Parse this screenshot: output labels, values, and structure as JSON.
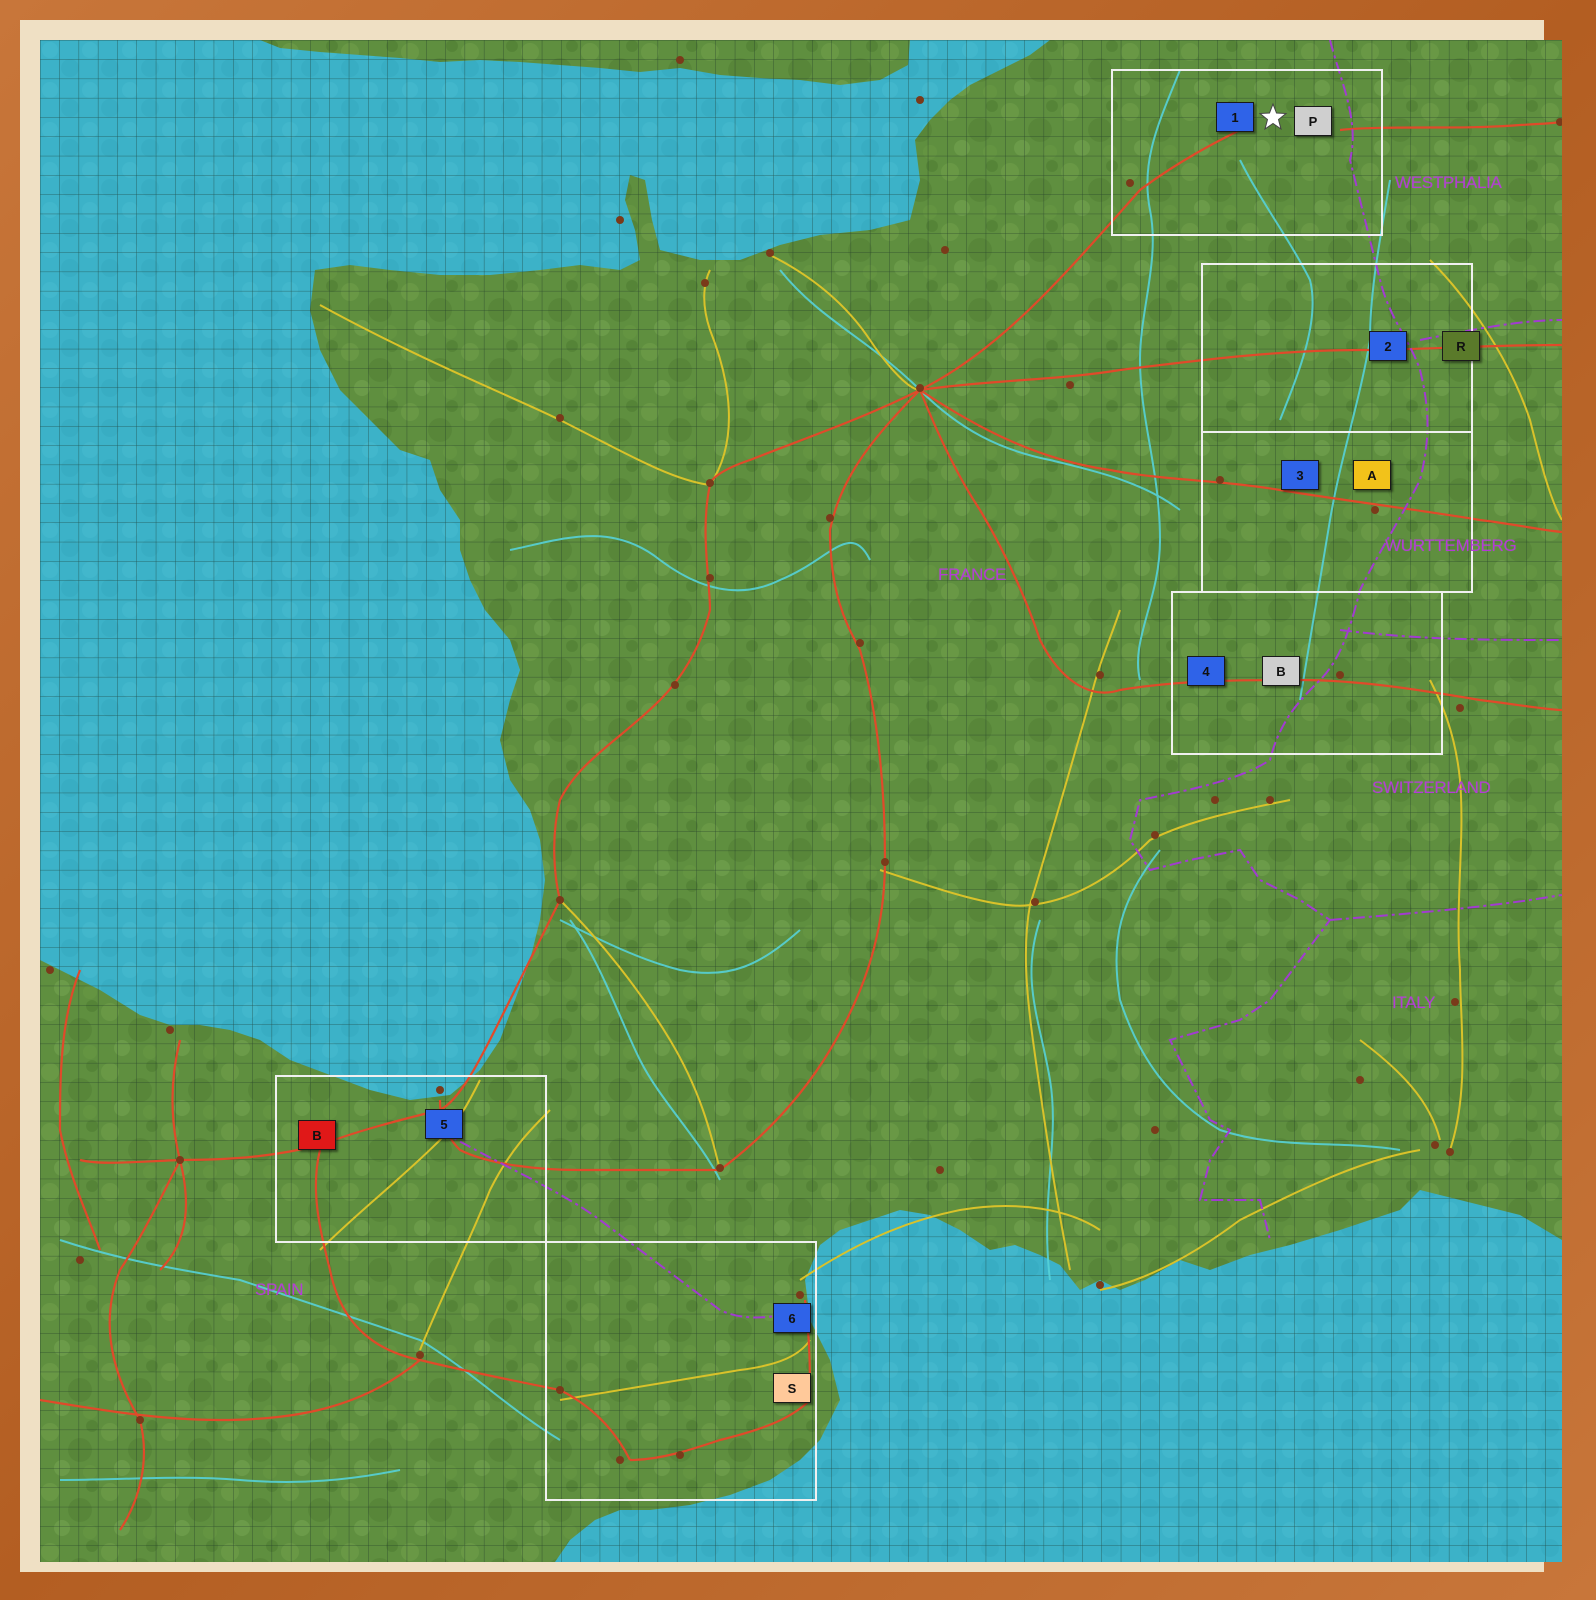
{
  "map": {
    "countries": [
      {
        "id": "westphalia",
        "label": "WESTPHALIA"
      },
      {
        "id": "wurttemberg",
        "label": "WURTTEMBERG"
      },
      {
        "id": "france",
        "label": "FRANCE"
      },
      {
        "id": "switzerland",
        "label": "SWITZERLAND"
      },
      {
        "id": "italy",
        "label": "ITALY"
      },
      {
        "id": "spain",
        "label": "SPAIN"
      }
    ],
    "colors": {
      "sea": "#3db3c9",
      "land": "#5f8f3f",
      "grid": "#1f3b2a",
      "road_main": "#e04a2a",
      "road_secondary": "#d9c22a",
      "river": "#56d2d8",
      "border": "#a23bd1",
      "sector_box": "#f0f0f0"
    }
  },
  "counters": [
    {
      "id": "unit-1",
      "label": "1",
      "color": "#2f63e8"
    },
    {
      "id": "unit-P",
      "label": "P",
      "color": "#cfcfcf"
    },
    {
      "id": "unit-2",
      "label": "2",
      "color": "#2f63e8"
    },
    {
      "id": "unit-R",
      "label": "R",
      "color": "#5a7a2a"
    },
    {
      "id": "unit-3",
      "label": "3",
      "color": "#2f63e8"
    },
    {
      "id": "unit-A",
      "label": "A",
      "color": "#f2c21a"
    },
    {
      "id": "unit-4",
      "label": "4",
      "color": "#2f63e8"
    },
    {
      "id": "unit-B-grey",
      "label": "B",
      "color": "#cfcfcf"
    },
    {
      "id": "unit-B-red",
      "label": "B",
      "color": "#e01818"
    },
    {
      "id": "unit-5",
      "label": "5",
      "color": "#2f63e8"
    },
    {
      "id": "unit-6",
      "label": "6",
      "color": "#2f63e8"
    },
    {
      "id": "unit-S",
      "label": "S",
      "color": "#ffc99a"
    }
  ],
  "objective_marker": {
    "icon": "star-icon"
  }
}
